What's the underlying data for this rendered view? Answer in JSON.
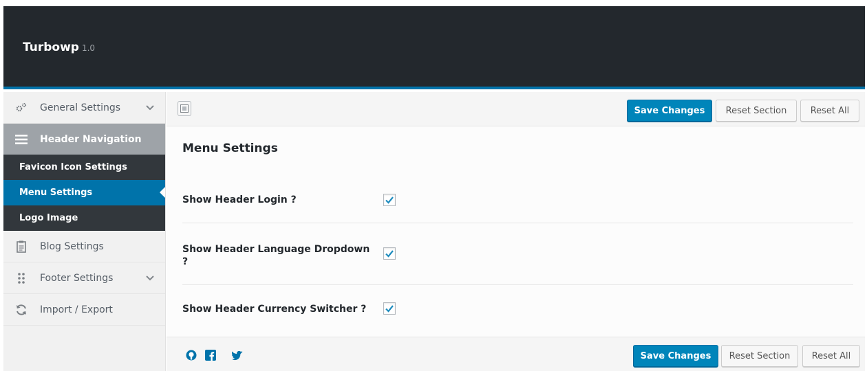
{
  "app": {
    "name": "Turbowp",
    "version": "1.0"
  },
  "sidebar": {
    "items": [
      {
        "label": "General Settings",
        "icon": "gears-icon",
        "has_children": true
      },
      {
        "label": "Header Navigation",
        "icon": "menu-icon",
        "active": true,
        "children": [
          {
            "label": "Favicon Icon Settings"
          },
          {
            "label": "Menu Settings",
            "current": true
          },
          {
            "label": "Logo Image"
          }
        ]
      },
      {
        "label": "Blog Settings",
        "icon": "clipboard-icon"
      },
      {
        "label": "Footer Settings",
        "icon": "dots-grid-icon",
        "has_children": true
      },
      {
        "label": "Import / Export",
        "icon": "refresh-icon"
      }
    ]
  },
  "toolbar": {
    "save_label": "Save Changes",
    "reset_section_label": "Reset Section",
    "reset_all_label": "Reset All"
  },
  "section": {
    "title": "Menu Settings",
    "fields": [
      {
        "label": "Show Header Login ?",
        "checked": true
      },
      {
        "label": "Show Header Language Dropdown ?",
        "checked": true
      },
      {
        "label": "Show Header Currency Switcher ?",
        "checked": true
      }
    ]
  },
  "footer": {
    "save_label": "Save Changes",
    "reset_section_label": "Reset Section",
    "reset_all_label": "Reset All",
    "social_icons": [
      "github-icon",
      "facebook-icon",
      "twitter-icon"
    ]
  },
  "colors": {
    "header_bg": "#23282d",
    "accent": "#0073aa",
    "primary_button": "#0085ba",
    "active_sidebar": "#9ea3a8",
    "submenu_bg": "#32373c"
  }
}
